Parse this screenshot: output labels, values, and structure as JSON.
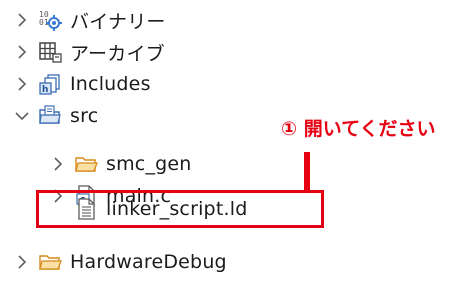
{
  "tree": {
    "items": [
      {
        "label": "バイナリー",
        "expanded": false,
        "icon": "binaries-icon"
      },
      {
        "label": "アーカイブ",
        "expanded": false,
        "icon": "archive-icon"
      },
      {
        "label": "Includes",
        "expanded": false,
        "icon": "includes-icon"
      },
      {
        "label": "src",
        "expanded": true,
        "icon": "source-folder-icon"
      },
      {
        "label": "smc_gen",
        "expanded": false,
        "icon": "folder-icon"
      },
      {
        "label": "main.c",
        "expanded": false,
        "icon": "c-file-icon"
      },
      {
        "label": "linker_script.ld",
        "icon": "text-file-icon"
      },
      {
        "label": "HardwareDebug",
        "expanded": false,
        "icon": "folder-icon"
      }
    ]
  },
  "annotation": {
    "text": "① 開いてください",
    "color": "#e60012"
  }
}
